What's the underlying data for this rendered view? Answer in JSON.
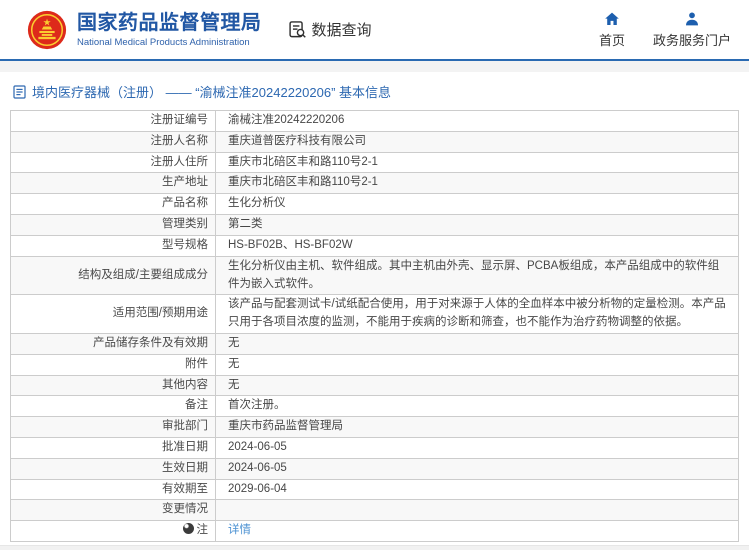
{
  "header": {
    "org_name_cn": "国家药品监督管理局",
    "org_name_en": "National Medical Products Administration",
    "data_query": "数据查询",
    "nav": {
      "home": "首页",
      "portal": "政务服务门户"
    }
  },
  "breadcrumb": "境内医疗器械（注册） —— “渝械注准20242220206” 基本信息",
  "table": {
    "rows": [
      {
        "label": "注册证编号",
        "value": "渝械注准20242220206"
      },
      {
        "label": "注册人名称",
        "value": "重庆道普医疗科技有限公司"
      },
      {
        "label": "注册人住所",
        "value": "重庆市北碚区丰和路110号2-1"
      },
      {
        "label": "生产地址",
        "value": "重庆市北碚区丰和路110号2-1"
      },
      {
        "label": "产品名称",
        "value": "生化分析仪"
      },
      {
        "label": "管理类别",
        "value": "第二类"
      },
      {
        "label": "型号规格",
        "value": "HS-BF02B、HS-BF02W"
      },
      {
        "label": "结构及组成/主要组成成分",
        "value": "生化分析仪由主机、软件组成。其中主机由外壳、显示屏、PCBA板组成，本产品组成中的软件组件为嵌入式软件。"
      },
      {
        "label": "适用范围/预期用途",
        "value": "该产品与配套测试卡/试纸配合使用，用于对来源于人体的全血样本中被分析物的定量检测。本产品只用于各项目浓度的监测，不能用于疾病的诊断和筛查，也不能作为治疗药物调整的依据。"
      },
      {
        "label": "产品储存条件及有效期",
        "value": "无"
      },
      {
        "label": "附件",
        "value": "无"
      },
      {
        "label": "其他内容",
        "value": "无"
      },
      {
        "label": "备注",
        "value": "首次注册。"
      },
      {
        "label": "审批部门",
        "value": "重庆市药品监督管理局"
      },
      {
        "label": "批准日期",
        "value": "2024-06-05"
      },
      {
        "label": "生效日期",
        "value": "2024-06-05"
      },
      {
        "label": "有效期至",
        "value": "2029-06-04"
      },
      {
        "label": "变更情况",
        "value": ""
      },
      {
        "label": "注",
        "value": "详情",
        "value_type": "link",
        "label_icon": "note-dot-icon"
      }
    ]
  },
  "colors": {
    "brand_blue": "#2157a4",
    "header_border_blue": "#2a6ab2",
    "breadcrumb_blue": "#2d68b1",
    "link_blue": "#4a90d2",
    "emblem_red": "#dd2a1b",
    "emblem_gold": "#fbcc30",
    "zebra_gray": "#f8f8f8"
  }
}
